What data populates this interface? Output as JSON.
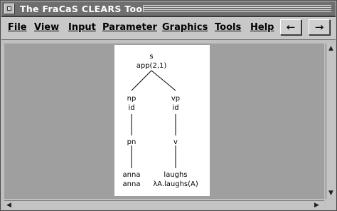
{
  "window": {
    "title": "The FraCaS CLEARS Tool"
  },
  "menu": {
    "items": [
      {
        "id": "file",
        "label": "File"
      },
      {
        "id": "view",
        "label": "View"
      },
      {
        "id": "input",
        "label": "Input"
      },
      {
        "id": "parameter",
        "label": "Parameter"
      },
      {
        "id": "graphics",
        "label": "Graphics"
      },
      {
        "id": "tools",
        "label": "Tools"
      },
      {
        "id": "help",
        "label": "Help"
      }
    ],
    "back_label": "←",
    "forward_label": "→"
  },
  "tree": {
    "root": {
      "category": "s",
      "rule": "app(2,1)"
    },
    "np": {
      "category": "np",
      "rule": "id"
    },
    "vp": {
      "category": "vp",
      "rule": "id"
    },
    "pn": {
      "category": "pn"
    },
    "v": {
      "category": "v"
    },
    "leaf_left": {
      "word": "anna",
      "semantics": "anna"
    },
    "leaf_right": {
      "word": "laughs",
      "semantics": "λA.laughs(A)"
    }
  }
}
